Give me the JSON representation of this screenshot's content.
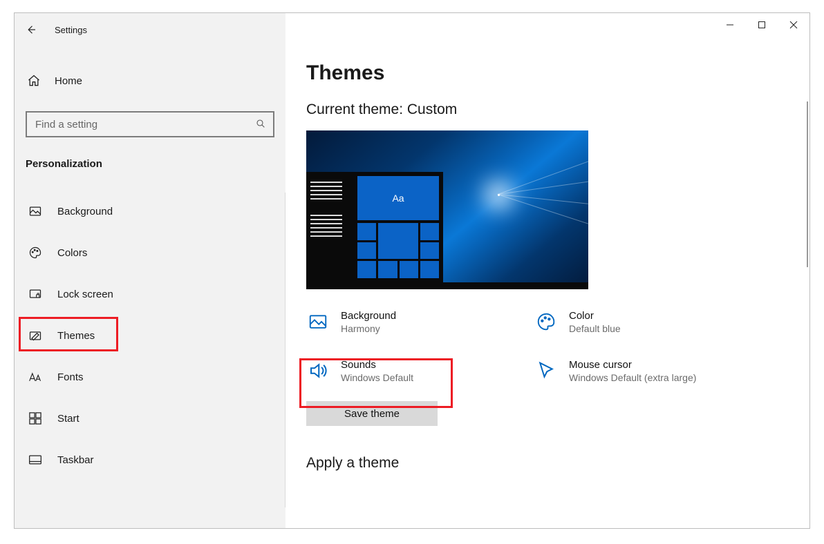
{
  "app_title": "Settings",
  "window_controls": {
    "min": "minimize",
    "max": "maximize",
    "close": "close"
  },
  "sidebar": {
    "home": "Home",
    "search_placeholder": "Find a setting",
    "category": "Personalization",
    "items": [
      {
        "icon": "image-icon",
        "label": "Background"
      },
      {
        "icon": "palette-icon",
        "label": "Colors"
      },
      {
        "icon": "lock-icon",
        "label": "Lock screen"
      },
      {
        "icon": "themes-icon",
        "label": "Themes"
      },
      {
        "icon": "fonts-icon",
        "label": "Fonts"
      },
      {
        "icon": "start-icon",
        "label": "Start"
      },
      {
        "icon": "taskbar-icon",
        "label": "Taskbar"
      }
    ]
  },
  "main": {
    "page_title": "Themes",
    "current_theme_label": "Current theme: Custom",
    "preview_tile_text": "Aa",
    "options": [
      {
        "title": "Background",
        "sub": "Harmony",
        "icon": "image-icon"
      },
      {
        "title": "Color",
        "sub": "Default blue",
        "icon": "palette-icon"
      },
      {
        "title": "Sounds",
        "sub": "Windows Default",
        "icon": "sound-icon"
      },
      {
        "title": "Mouse cursor",
        "sub": "Windows Default (extra large)",
        "icon": "cursor-icon"
      }
    ],
    "save_button": "Save theme",
    "apply_title": "Apply a theme"
  },
  "colors": {
    "accent": "#0067c0"
  }
}
